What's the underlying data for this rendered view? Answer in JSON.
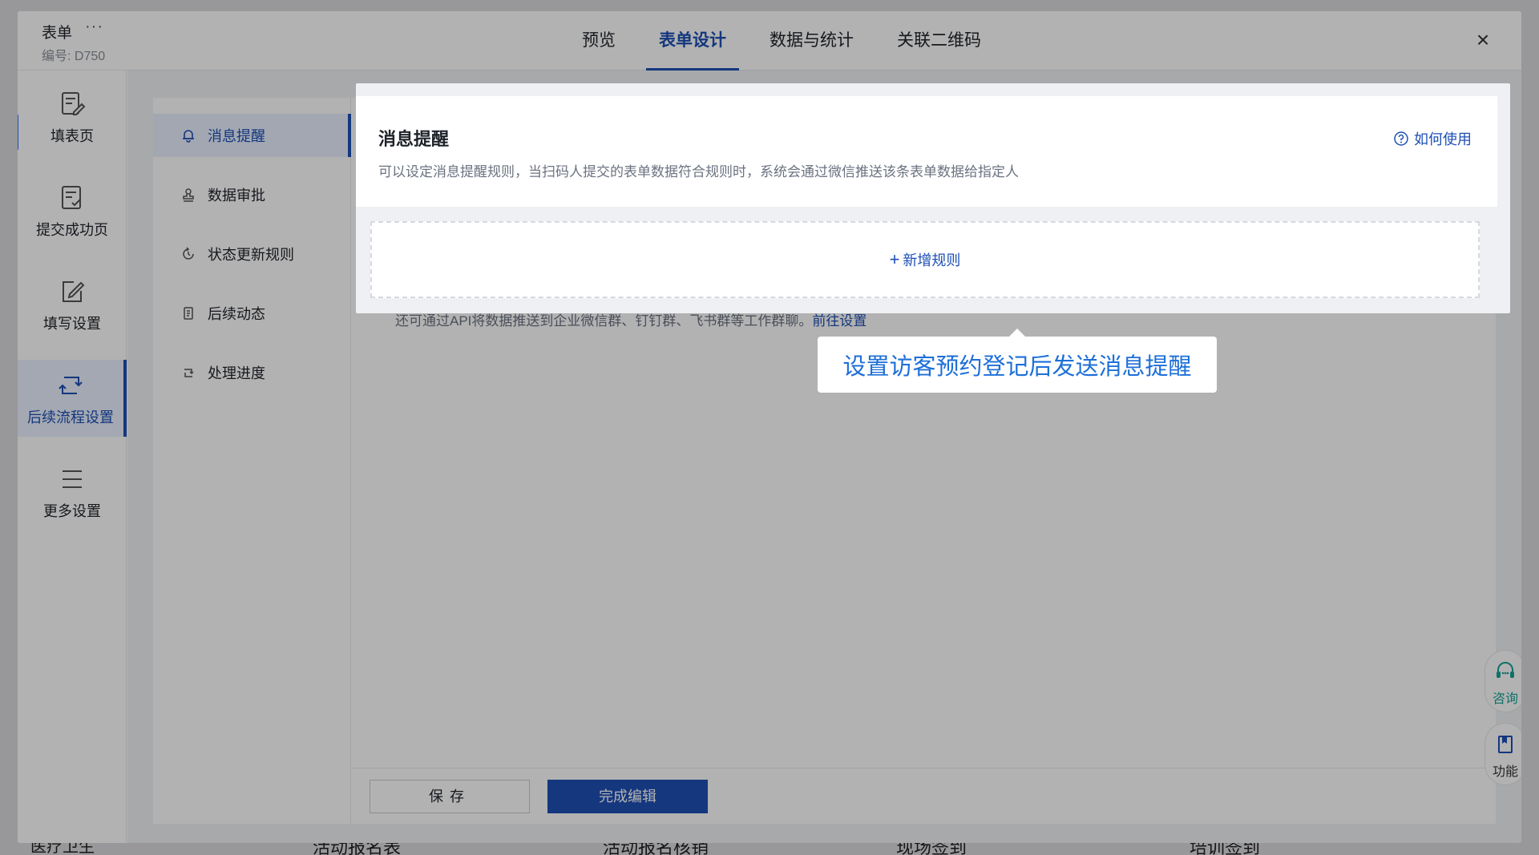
{
  "background": {
    "bottom_items": [
      "医疗卫生",
      "活动报名表",
      "活动报名核销",
      "现场签到",
      "培训签到"
    ]
  },
  "header": {
    "form_title": "表单",
    "more": "···",
    "form_code": "编号: D750",
    "tabs": [
      {
        "label": "预览"
      },
      {
        "label": "表单设计"
      },
      {
        "label": "数据与统计"
      },
      {
        "label": "关联二维码"
      }
    ],
    "active_tab": "表单设计",
    "close": "×"
  },
  "left_nav": {
    "items": [
      {
        "label": "填表页",
        "icon": "form-edit-icon"
      },
      {
        "label": "提交成功页",
        "icon": "submit-success-icon"
      },
      {
        "label": "填写设置",
        "icon": "edit-settings-icon"
      },
      {
        "label": "后续流程设置",
        "icon": "workflow-icon"
      },
      {
        "label": "更多设置",
        "icon": "menu-lines-icon"
      }
    ],
    "active": "后续流程设置"
  },
  "sub_nav": {
    "items": [
      {
        "label": "消息提醒",
        "icon": "bell-icon"
      },
      {
        "label": "数据审批",
        "icon": "stamp-icon"
      },
      {
        "label": "状态更新规则",
        "icon": "status-cycle-icon"
      },
      {
        "label": "后续动态",
        "icon": "document-icon"
      },
      {
        "label": "处理进度",
        "icon": "progress-icon"
      }
    ],
    "active": "消息提醒"
  },
  "message_reminder": {
    "title": "消息提醒",
    "description": "可以设定消息提醒规则，当扫码人提交的表单数据符合规则时，系统会通过微信推送该条表单数据给指定人",
    "help_label": "如何使用",
    "add_rule_label": "新增规则",
    "add_rule_plus": "+"
  },
  "api_note": {
    "text": "还可通过API将数据推送到企业微信群、钉钉群、飞书群等工作群聊。",
    "link": "前往设置"
  },
  "tooltip": {
    "text": "设置访客预约登记后发送消息提醒"
  },
  "footer": {
    "save_label": "保存",
    "done_label": "完成编辑"
  },
  "float_buttons": {
    "consult_label": "咨询",
    "function_label": "功能"
  },
  "colors": {
    "accent": "#1d4fb5",
    "tooltip_text": "#1d6fd8",
    "consult": "#16a394"
  }
}
